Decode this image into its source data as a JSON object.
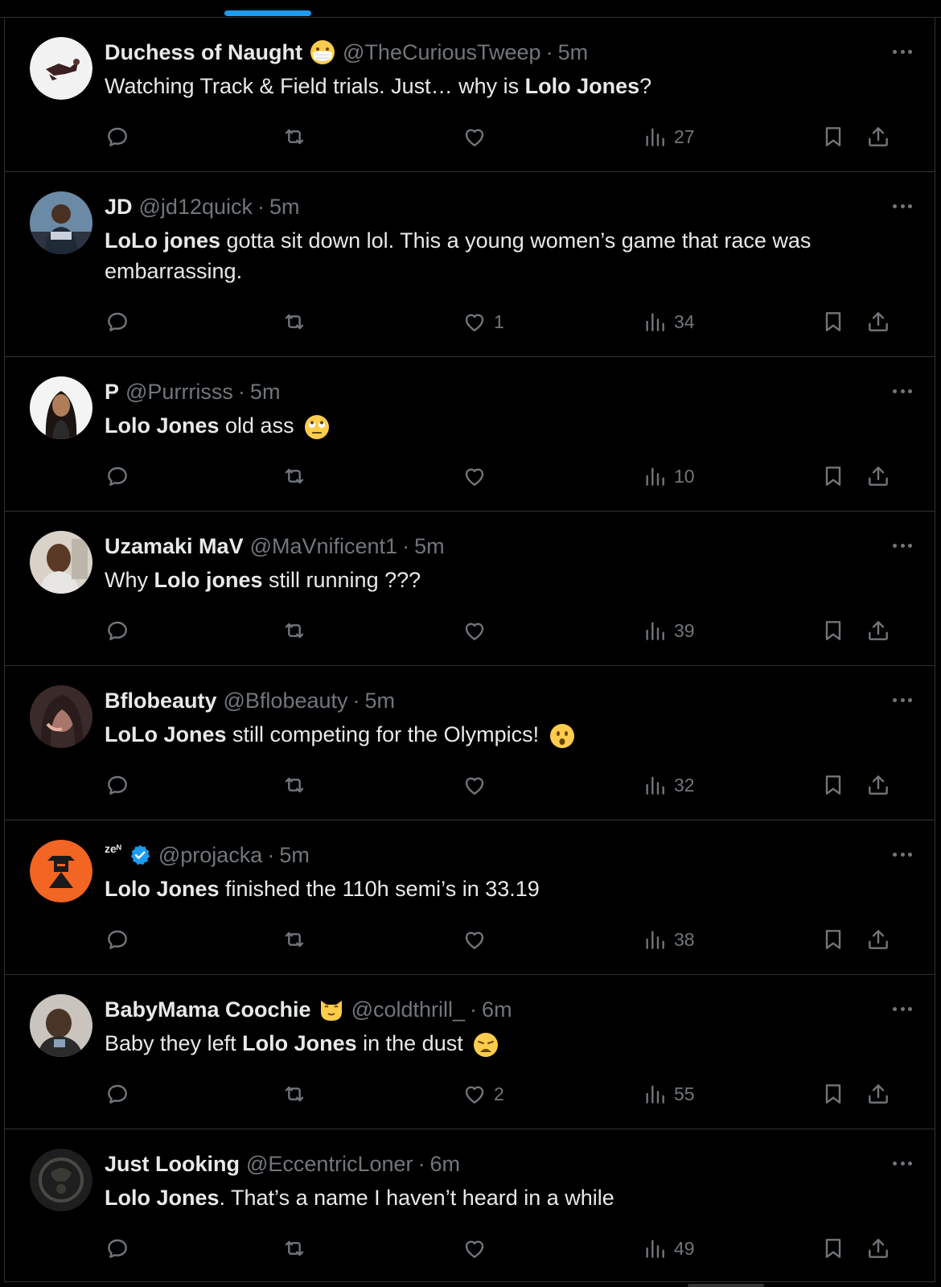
{
  "colors": {
    "background": "#000000",
    "text": "#e7e9ea",
    "muted": "#71767b",
    "accent": "#1d9bf0",
    "divider": "#2f3336"
  },
  "tweets": [
    {
      "name": "Duchess of Naught",
      "name_emoji": "face-with-medical-mask",
      "handle": "@TheCuriousTweep",
      "sep": "·",
      "time": "5m",
      "text": [
        {
          "t": "Watching Track & Field trials.  Just… why is "
        },
        {
          "t": "Lolo Jones",
          "b": true
        },
        {
          "t": "?"
        }
      ],
      "likes": "",
      "views": "27"
    },
    {
      "name": "JD",
      "handle": "@jd12quick",
      "sep": "·",
      "time": "5m",
      "text": [
        {
          "t": "LoLo jones",
          "b": true
        },
        {
          "t": " gotta sit down lol. This a young women’s game that race was embarrassing."
        }
      ],
      "likes": "1",
      "views": "34"
    },
    {
      "name": "P",
      "handle": "@Purrrisss",
      "sep": "·",
      "time": "5m",
      "text": [
        {
          "t": "Lolo Jones",
          "b": true
        },
        {
          "t": " old ass "
        },
        {
          "e": "face-with-rolling-eyes"
        }
      ],
      "likes": "",
      "views": "10"
    },
    {
      "name": "Uzamaki MaV",
      "handle": "@MaVnificent1",
      "sep": "·",
      "time": "5m",
      "text": [
        {
          "t": "Why "
        },
        {
          "t": "Lolo jones",
          "b": true
        },
        {
          "t": " still running ???"
        }
      ],
      "likes": "",
      "views": "39"
    },
    {
      "name": "Bflobeauty",
      "handle": "@Bflobeauty",
      "sep": "·",
      "time": "5m",
      "text": [
        {
          "t": "LoLo Jones",
          "b": true
        },
        {
          "t": " still competing for the Olympics! "
        },
        {
          "e": "hushed-face"
        }
      ],
      "likes": "",
      "views": "32"
    },
    {
      "name": "zeᴺ",
      "verified": true,
      "handle": "@projacka",
      "sep": "·",
      "time": "5m",
      "text": [
        {
          "t": "Lolo Jones",
          "b": true
        },
        {
          "t": " finished the 110h semi’s in 33.19"
        }
      ],
      "likes": "",
      "views": "38"
    },
    {
      "name": "BabyMama Coochie",
      "name_emoji": "cat-face",
      "handle": "@coldthrill_",
      "sep": "·",
      "time": "6m",
      "text": [
        {
          "t": "Baby they left "
        },
        {
          "t": "Lolo Jones",
          "b": true
        },
        {
          "t": " in the dust "
        },
        {
          "e": "weary-face"
        }
      ],
      "likes": "2",
      "views": "55"
    },
    {
      "name": "Just Looking",
      "handle": "@EccentricLoner",
      "sep": "·",
      "time": "6m",
      "text": [
        {
          "t": "Lolo Jones",
          "b": true
        },
        {
          "t": ". That’s a name I haven’t heard in a while"
        }
      ],
      "likes": "",
      "views": "49"
    }
  ]
}
